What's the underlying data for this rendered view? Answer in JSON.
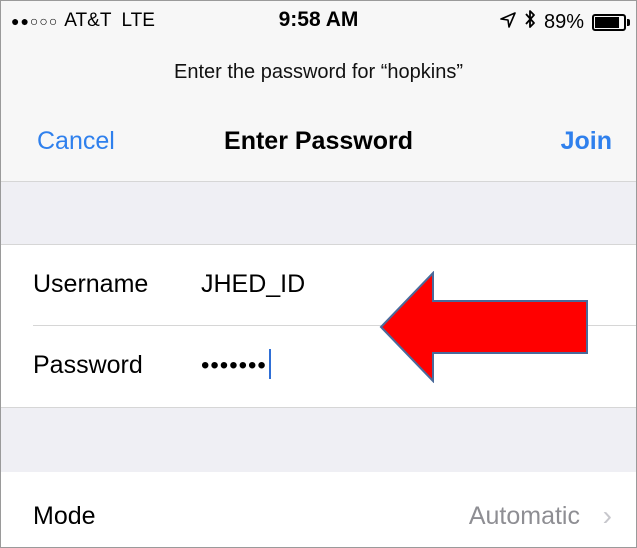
{
  "status_bar": {
    "signal": "●●○○○",
    "carrier": "AT&T",
    "network": "LTE",
    "time": "9:58 AM",
    "location_icon": "location-arrow-icon",
    "bluetooth_icon": "bluetooth-icon",
    "battery": "89%"
  },
  "prompt": "Enter the password for “hopkins”",
  "navbar": {
    "cancel_label": "Cancel",
    "title": "Enter Password",
    "join_label": "Join"
  },
  "fields": {
    "username_label": "Username",
    "username_value": "JHED_ID",
    "password_label": "Password",
    "password_value": "•••••••"
  },
  "mode": {
    "label": "Mode",
    "value": "Automatic",
    "chevron": "›"
  },
  "colors": {
    "accent": "#2f80ed",
    "arrow_fill": "#ff0000",
    "arrow_stroke": "#4a6a9a",
    "section_gap": "#efeff4"
  }
}
